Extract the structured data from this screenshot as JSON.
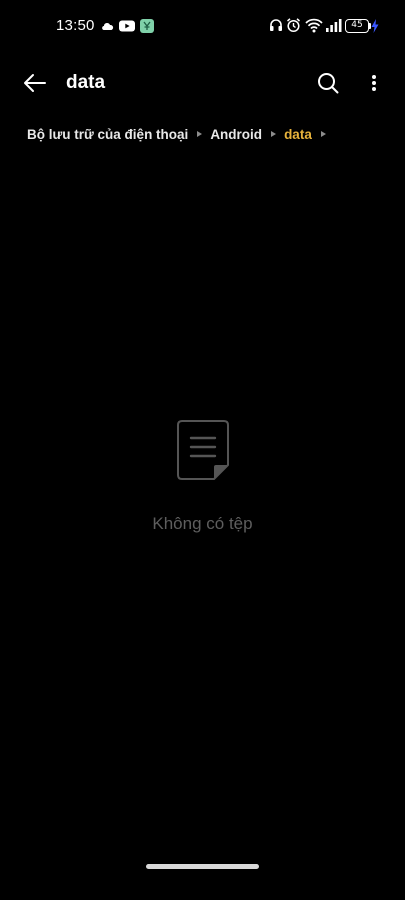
{
  "status_bar": {
    "time": "13:50",
    "battery_level": "45",
    "left_icons": [
      "weather-cloud-icon",
      "youtube-icon",
      "app-icon"
    ],
    "right_icons": [
      "headphones-icon",
      "alarm-icon",
      "wifi-icon",
      "signal-icon",
      "battery-icon",
      "charging-icon"
    ]
  },
  "app_bar": {
    "title": "data",
    "back_icon": "arrow-left-icon",
    "search_icon": "search-icon",
    "more_icon": "more-vertical-icon"
  },
  "breadcrumb": {
    "items": [
      {
        "label": "Bộ lưu trữ của điện thoại"
      },
      {
        "label": "Android"
      },
      {
        "label": "data"
      }
    ],
    "active_index": 2
  },
  "empty_state": {
    "icon": "document-icon",
    "message": "Không có tệp"
  },
  "colors": {
    "background": "#000000",
    "text_primary": "#ffffff",
    "breadcrumb_active": "#e8b33c",
    "empty_text": "#5e5e5e",
    "youtube_red": "#ff0000",
    "app_icon_green": "#7fd1a9"
  }
}
